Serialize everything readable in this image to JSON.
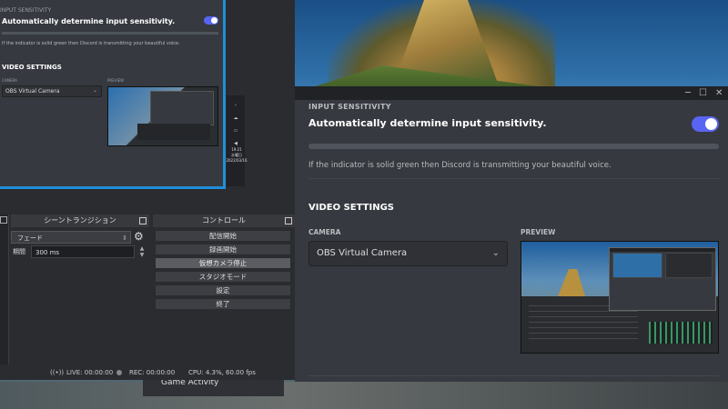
{
  "obs": {
    "mini_discord": {
      "input_sensitivity_header": "INPUT SENSITIVITY",
      "auto_sensitivity_label": "Automatically determine input sensitivity.",
      "info_text": "If the indicator is solid green then Discord is transmitting your beautiful voice.",
      "video_settings_header": "VIDEO SETTINGS",
      "camera_label": "CAMERA",
      "camera_value": "OBS Virtual Camera",
      "preview_label": "PREVIEW",
      "clock_time": "19:21",
      "clock_weekday": "水曜日",
      "clock_date": "2022/03/16"
    },
    "scene_transitions": {
      "title": "シーントランジション",
      "transition_value": "フェード",
      "duration_label": "期間",
      "duration_value": "300 ms"
    },
    "controls": {
      "title": "コントロール",
      "buttons": [
        "配信開始",
        "録画開始",
        "仮想カメラ停止",
        "スタジオモード",
        "設定",
        "終了"
      ],
      "active_index": 2
    },
    "status": {
      "live": "LIVE: 00:00:00",
      "rec": "REC: 00:00:00",
      "cpu": "CPU: 4.3%, 60.00 fps"
    }
  },
  "discord": {
    "window_controls": {
      "minimize": "─",
      "maximize": "☐",
      "close": "✕"
    },
    "input_sensitivity_header": "INPUT SENSITIVITY",
    "auto_sensitivity_label": "Automatically determine input sensitivity.",
    "auto_sensitivity_enabled": true,
    "info_text": "If the indicator is solid green then Discord is transmitting your beautiful voice.",
    "video_settings_header": "VIDEO SETTINGS",
    "camera_label": "CAMERA",
    "camera_value": "OBS Virtual Camera",
    "preview_label": "PREVIEW",
    "accent_color": "#5865f2"
  },
  "behind_window": {
    "game_activity": "Game Activity"
  }
}
